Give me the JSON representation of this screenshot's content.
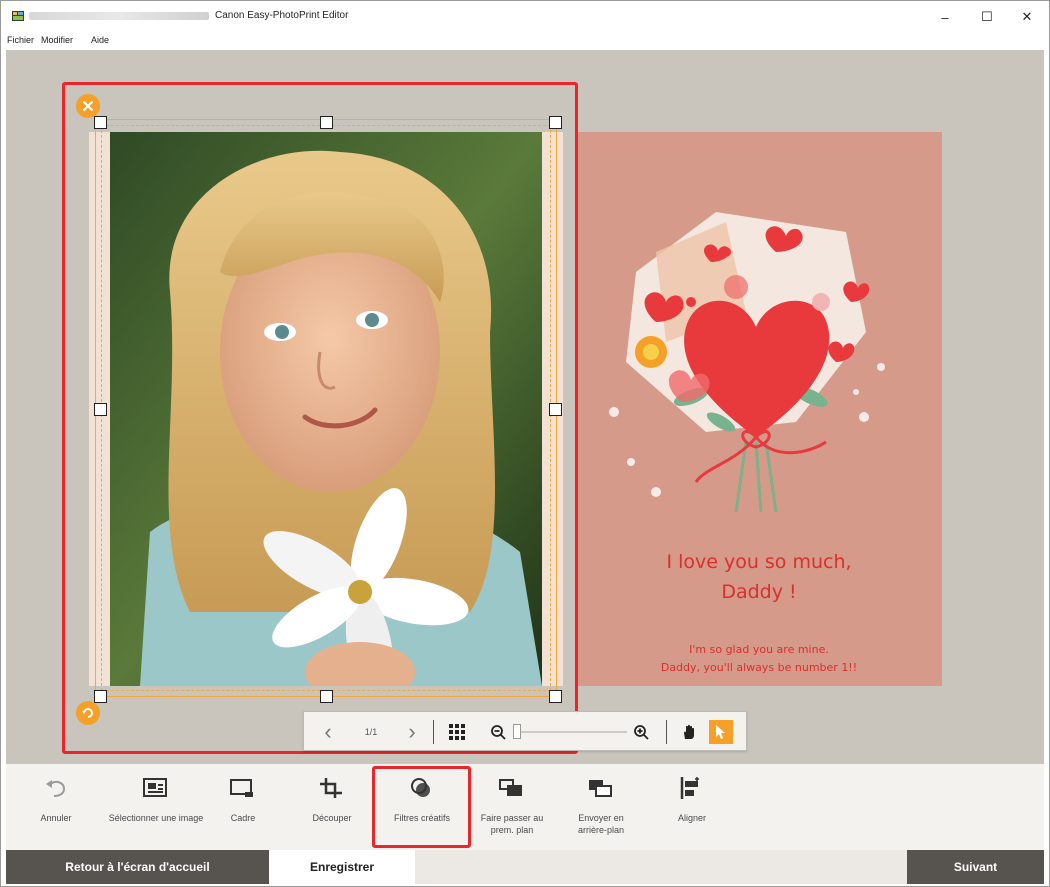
{
  "window": {
    "title": "Canon Easy-PhotoPrint Editor",
    "minimize_glyph": "–",
    "maximize_glyph": "☐",
    "close_glyph": "✕"
  },
  "menu": {
    "items": [
      "Fichier",
      "Modifier",
      "Aide"
    ]
  },
  "card": {
    "line1": "I love you so much,",
    "line2": "Daddy !",
    "line3": "I'm so glad you are mine.",
    "line4": "Daddy, you'll always be number 1!!",
    "background": "#d69a8b",
    "text_color": "#d8302c"
  },
  "photo": {
    "description_icon": "portrait-photo"
  },
  "selection": {
    "color": "#e8262b",
    "accent": "#f5a028"
  },
  "page_nav": {
    "prev_glyph": "‹",
    "next_glyph": "›",
    "page_indicator": "1/1"
  },
  "toolbar": {
    "items": [
      {
        "label": "Annuler",
        "icon": "undo-icon"
      },
      {
        "label": "Sélectionner une image",
        "icon": "select-image-icon"
      },
      {
        "label": "Cadre",
        "icon": "frame-icon"
      },
      {
        "label": "Découper",
        "icon": "crop-icon"
      },
      {
        "label": "Filtres créatifs",
        "icon": "creative-filters-icon"
      },
      {
        "label": "Faire passer au prem. plan",
        "icon": "bring-to-front-icon"
      },
      {
        "label": "Envoyer en arrière-plan",
        "icon": "send-to-back-icon"
      },
      {
        "label": "Aligner",
        "icon": "align-icon"
      }
    ]
  },
  "footer": {
    "home": "Retour à l'écran d'accueil",
    "save": "Enregistrer",
    "next": "Suivant"
  }
}
